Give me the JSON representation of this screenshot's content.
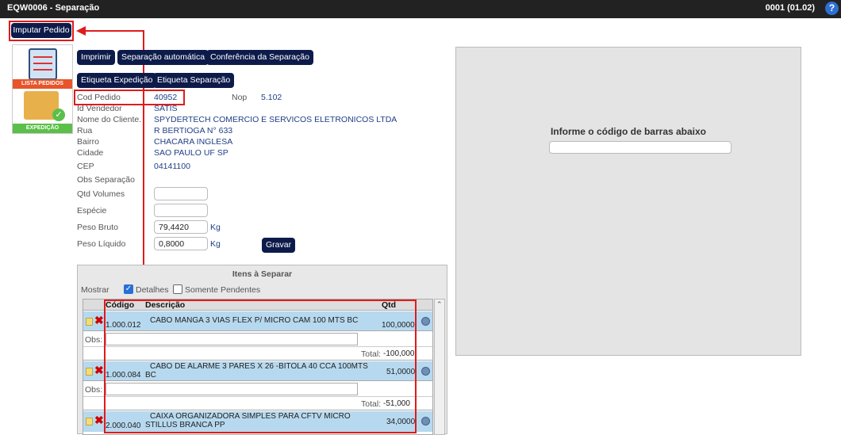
{
  "header": {
    "title": "EQW0006 - Separação",
    "version": "0001 (01.02)",
    "help": "?"
  },
  "toolbar": {
    "imputar": "Imputar Pedido",
    "imprimir": "Imprimir",
    "separacao_auto": "Separação automática",
    "conferencia": "Conferência da Separação",
    "etiqueta_expedicao": "Etiqueta Expedição",
    "etiqueta_separacao": "Etiqueta Separação",
    "gravar": "Gravar"
  },
  "logo": {
    "top_label": "LISTA PEDIDOS",
    "bottom_label": "EXPEDIÇÃO"
  },
  "order": {
    "cod_pedido_label": "Cod Pedido",
    "cod_pedido": "40952",
    "nop_label": "Nop",
    "nop": "5.102",
    "vendedor_label": "Id Vendedor",
    "vendedor": "SATIS",
    "cliente_label": "Nome do Cliente.",
    "cliente": "SPYDERTECH COMERCIO E SERVICOS ELETRONICOS LTDA",
    "rua_label": "Rua",
    "rua": "R BERTIOGA  N°  633",
    "bairro_label": "Bairro",
    "bairro": "CHACARA INGLESA",
    "cidade_label": "Cidade",
    "cidade": "SAO PAULO  UF  SP",
    "cep_label": "CEP",
    "cep": "04141100",
    "obs_label": "Obs Separação",
    "volumes_label": "Qtd Volumes",
    "volumes": "",
    "especie_label": "Espécie",
    "especie": "",
    "peso_bruto_label": "Peso Bruto",
    "peso_bruto": "79,4420",
    "peso_liquido_label": "Peso Líquido",
    "peso_liquido": "0,8000",
    "kg": "Kg"
  },
  "barcode": {
    "label": "Informe o código de barras abaixo",
    "value": ""
  },
  "items": {
    "title": "Itens à Separar",
    "mostrar": "Mostrar",
    "detalhes": "Detalhes",
    "detalhes_checked": true,
    "pendentes": "Somente Pendentes",
    "pendentes_checked": false,
    "col_codigo": "Código",
    "col_descricao": "Descrição",
    "col_qtd": "Qtd",
    "obs_label": "Obs:",
    "total_label": "Total:",
    "rows": [
      {
        "codigo": "1.000.012",
        "descricao": "CABO MANGA 3 VIAS FLEX P/ MICRO CAM 100 MTS BC",
        "qtd": "100,0000",
        "total": "-100,000"
      },
      {
        "codigo": "1.000.084",
        "descricao": "CABO DE ALARME 3 PARES X 26 -BITOLA 40 CCA 100MTS BC",
        "qtd": "51,0000",
        "total": "-51,000"
      },
      {
        "codigo": "2.000.040",
        "descricao": "CAIXA ORGANIZADORA SIMPLES PARA CFTV MICRO STILLUS BRANCA PP",
        "qtd": "34,0000"
      }
    ]
  }
}
